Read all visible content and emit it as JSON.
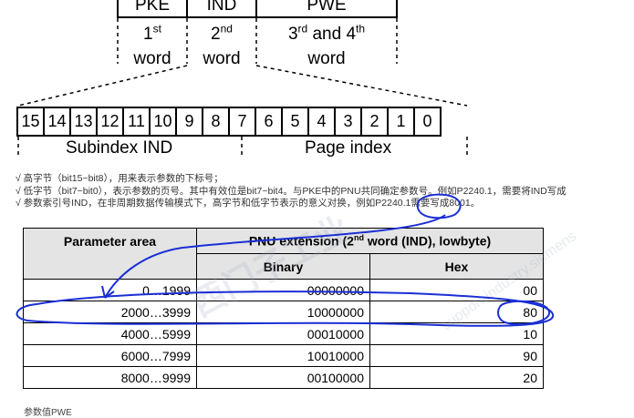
{
  "words": {
    "pke": {
      "box": "PKE",
      "label_num": "1",
      "label_sup": "st",
      "label_word": "word"
    },
    "ind": {
      "box": "IND",
      "label_num": "2",
      "label_sup": "nd",
      "label_word": "word"
    },
    "pwe": {
      "box": "PWE",
      "label_a": "3",
      "label_a_sup": "rd",
      "label_and": " and 4",
      "label_b_sup": "th",
      "label_word": "word"
    }
  },
  "bits": [
    "15",
    "14",
    "13",
    "12",
    "11",
    "10",
    "9",
    "8",
    "7",
    "6",
    "5",
    "4",
    "3",
    "2",
    "1",
    "0"
  ],
  "bit_labels": {
    "subindex": "Subindex IND",
    "page": "Page index"
  },
  "notes": [
    "√ 高字节（bit15~bit8），用来表示参数的下标号；",
    "√ 低字节（bit7~bit0），表示参数的页号。其中有效位是bit7~bit4。与PKE中的PNU共同确定参数号。例如P2240.1，需要将IND写成",
    "√ 参数索引号IND，在非周期数据传输模式下，高字节和低字节表示的意义对换，例如P2240.1需要写成8001。"
  ],
  "table": {
    "header_param": "Parameter area",
    "header_pnu_a": "PNU extension (2",
    "header_pnu_sup": "nd",
    "header_pnu_b": " word (IND), lowbyte)",
    "header_binary": "Binary",
    "header_hex": "Hex",
    "rows": [
      {
        "area": "0…1999",
        "binary": "00000000",
        "hex": "00"
      },
      {
        "area": "2000…3999",
        "binary": "10000000",
        "hex": "80"
      },
      {
        "area": "4000…5999",
        "binary": "00010000",
        "hex": "10"
      },
      {
        "area": "6000…7999",
        "binary": "10010000",
        "hex": "90"
      },
      {
        "area": "8000…9999",
        "binary": "00100000",
        "hex": "20"
      }
    ]
  },
  "watermark": {
    "text_cn": "西门子工业",
    "text_en": "support.industry.siemens"
  },
  "bottom_text": "参数值PWE",
  "annotation_color": "#1a2fd6"
}
